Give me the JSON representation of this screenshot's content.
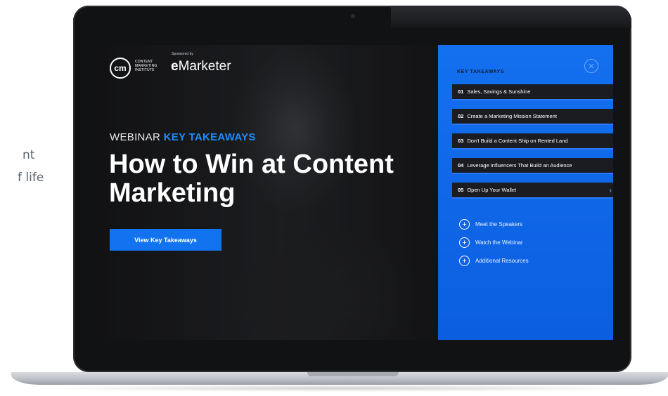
{
  "side_text": {
    "line1": "nt",
    "line2": "f life"
  },
  "logo": {
    "mark": "cm",
    "name": "CONTENT MARKETING INSTITUTE"
  },
  "sponsor": {
    "label": "Sponsored by",
    "name_prefix": "e",
    "name_rest": "Marketer"
  },
  "hero": {
    "kicker": "WEBINAR",
    "kicker_accent": "KEY TAKEAWAYS",
    "headline": "How to Win at Content Marketing",
    "cta": "View Key Takeaways"
  },
  "panel": {
    "title": "KEY TAKEAWAYS",
    "close_icon": "close-icon",
    "items": [
      {
        "num": "01",
        "label": "Sales, Savings & Sunshine"
      },
      {
        "num": "02",
        "label": "Create a Marketing Mission Statement"
      },
      {
        "num": "03",
        "label": "Don't Build a Content Ship on Rented Land"
      },
      {
        "num": "04",
        "label": "Leverage Influencers That Build an Audience"
      },
      {
        "num": "05",
        "label": "Open Up Your Wallet"
      }
    ],
    "links": [
      {
        "label": "Meet the Speakers"
      },
      {
        "label": "Watch the Webinar"
      },
      {
        "label": "Additional Resources"
      }
    ]
  },
  "colors": {
    "accent": "#1173f0",
    "panel": "#1470ef",
    "dark_item": "#1a1c21"
  }
}
